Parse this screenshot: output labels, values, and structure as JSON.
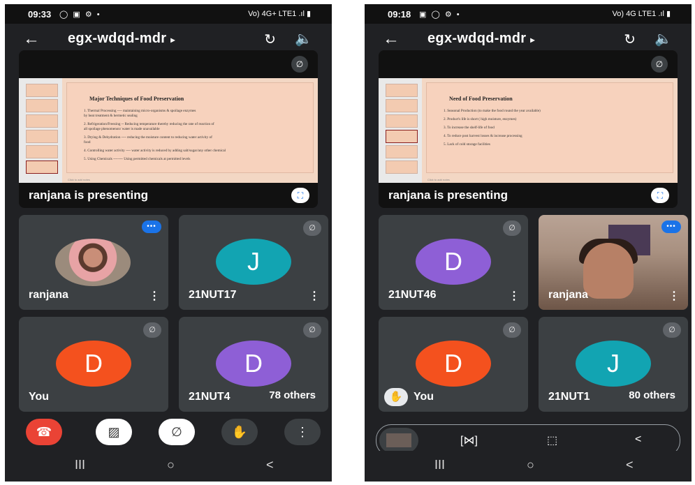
{
  "left": {
    "status_time": "09:33",
    "status_icons": "◯ ▣ ⚙ •",
    "network": "Vo) 4G+ LTE1 .ıl ▮",
    "meeting_code": "egx-wdqd-mdr",
    "presenter_label": "ranjana is presenting",
    "slide": {
      "title": "Major Techniques of Food Preservation",
      "lines": [
        "1.   Thermal Processing  ---- maintaining micro-organisms & spoilage enzymes",
        "        by heat treatment & hermetic sealing",
        "2.   Refrigeration/Freezing  -- Reducing temperature thereby reducing the rate of reaction of",
        "        all spoilage phenomenon/ water is made unavailable",
        "3.   Drying & Dehydration  ---- reducing the moisture content to reducing water activity of",
        "        food",
        "4.   Controlling water activity  ---- water activity is reduced by adding salt/sugar/any other chemical",
        "5.   Using Chemicals  -------- Using permitted chemicals at permitted levels"
      ],
      "notes": "Click to add notes"
    },
    "tiles": [
      {
        "name": "ranjana",
        "type": "photo"
      },
      {
        "name": "21NUT17",
        "initial": "J",
        "color": "#12a4b2"
      },
      {
        "name": "You",
        "initial": "D",
        "color": "#f4511e"
      },
      {
        "name": "21NUT4",
        "initial": "D",
        "color": "#8e5fd6",
        "others": "78 others"
      }
    ]
  },
  "right": {
    "status_time": "09:18",
    "status_icons": "▣ ◯ ⚙ •",
    "network": "Vo) 4G LTE1 .ıl ▮",
    "meeting_code": "egx-wdqd-mdr",
    "presenter_label": "ranjana is presenting",
    "slide": {
      "title": "Need of Food Preservation",
      "lines": [
        "1.   Seasonal Production (to make the food round the year available)",
        "2.   Product's life is short ( high moisture, enzymes)",
        "3.   To increase the shelf-life of food",
        "4.   To reduce post harvest losses  &  increase processing",
        "5.   Lack of cold storage facilities"
      ],
      "notes": "Click to add notes"
    },
    "tiles": [
      {
        "name": "21NUT46",
        "initial": "D",
        "color": "#8e5fd6"
      },
      {
        "name": "ranjana",
        "type": "video"
      },
      {
        "name": "You",
        "initial": "D",
        "color": "#f4511e"
      },
      {
        "name": "21NUT1",
        "initial": "J",
        "color": "#12a4b2",
        "others": "80 others"
      }
    ]
  },
  "icons": {
    "back": "←",
    "caret": "▸",
    "switch_camera": "↻",
    "speaker": "🔈",
    "mic_off": "∅",
    "fullscreen": "⛶",
    "more": "⋮",
    "hand": "✋",
    "end_call": "☎",
    "cam_off": "▨",
    "speaking": "•••",
    "nav_recent": "III",
    "nav_home": "○",
    "nav_back": "<",
    "cast_scan": "[⋈]",
    "cast_crop": "⬚",
    "cast_share": "<"
  }
}
